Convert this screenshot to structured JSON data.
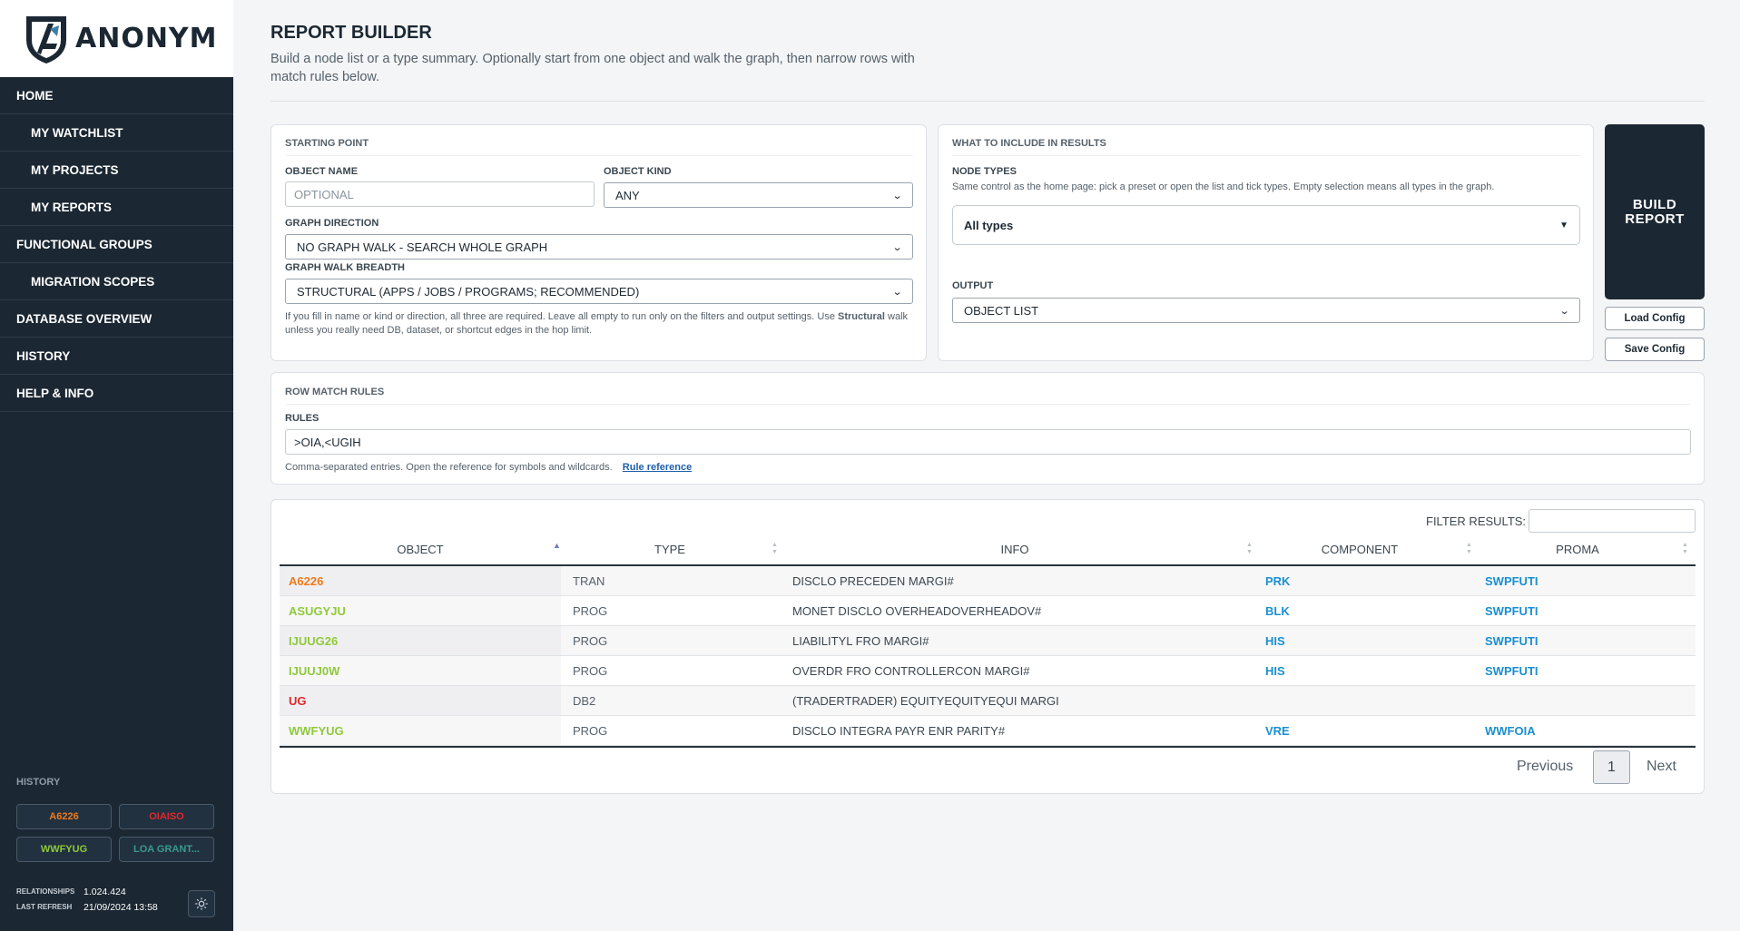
{
  "brand": {
    "name": "ANONYM"
  },
  "nav": [
    {
      "label": "HOME",
      "sub": false
    },
    {
      "label": "MY WATCHLIST",
      "sub": true
    },
    {
      "label": "MY PROJECTS",
      "sub": true
    },
    {
      "label": "MY REPORTS",
      "sub": true
    },
    {
      "label": "FUNCTIONAL GROUPS",
      "sub": false
    },
    {
      "label": "MIGRATION SCOPES",
      "sub": true
    },
    {
      "label": "DATABASE OVERVIEW",
      "sub": false
    },
    {
      "label": "HISTORY",
      "sub": false
    },
    {
      "label": "HELP & INFO",
      "sub": false
    }
  ],
  "history": {
    "title": "HISTORY",
    "chips": [
      {
        "label": "A6226",
        "color": "#f07a1a"
      },
      {
        "label": "OIAISO",
        "color": "#e0282c"
      },
      {
        "label": "WWFYUG",
        "color": "#8fc93a"
      },
      {
        "label": "LOA GRANT...",
        "color": "#3a9a8c"
      }
    ]
  },
  "stats": {
    "relationships_label": "RELATIONSHIPS",
    "relationships_value": "1.024.424",
    "refresh_label": "LAST REFRESH",
    "refresh_value": "21/09/2024 13:58"
  },
  "header": {
    "title": "REPORT BUILDER",
    "description": "Build a node list or a type summary. Optionally start from one object and walk the graph, then narrow rows with match rules below."
  },
  "starting_point": {
    "title": "STARTING POINT",
    "object_name_label": "OBJECT NAME",
    "object_name_placeholder": "OPTIONAL",
    "object_kind_label": "OBJECT KIND",
    "object_kind_value": "ANY",
    "graph_direction_label": "GRAPH DIRECTION",
    "graph_direction_value": "NO GRAPH WALK - SEARCH WHOLE GRAPH",
    "walk_breadth_label": "GRAPH WALK BREADTH",
    "walk_breadth_value": "STRUCTURAL (APPS / JOBS / PROGRAMS; RECOMMENDED)",
    "help_pre": "If you fill in name or kind or direction, all three are required. Leave all empty to run only on the filters and output settings. Use ",
    "help_bold": "Structural",
    "help_post": " walk unless you really need DB, dataset, or shortcut edges in the hop limit."
  },
  "include": {
    "title": "WHAT TO INCLUDE IN RESULTS",
    "node_types_label": "NODE TYPES",
    "node_types_help": "Same control as the home page: pick a preset or open the list and tick types. Empty selection means all types in the graph.",
    "node_types_value": "All types",
    "output_label": "OUTPUT",
    "output_value": "OBJECT LIST"
  },
  "actions": {
    "build_line1": "BUILD",
    "build_line2": "REPORT",
    "load": "Load Config",
    "save": "Save Config"
  },
  "rules": {
    "title": "ROW MATCH RULES",
    "label": "RULES",
    "value": ">OIA,<UGIH",
    "help": "Comma-separated entries. Open the reference for symbols and wildcards.",
    "link": "Rule reference"
  },
  "results": {
    "filter_label": "FILTER RESULTS:",
    "filter_value": "",
    "columns": [
      "OBJECT",
      "TYPE",
      "INFO",
      "COMPONENT",
      "PROMA"
    ],
    "rows": [
      {
        "object": "A6226",
        "object_color": "#f07a1a",
        "type": "TRAN",
        "info": "DISCLO PRECEDEN MARGI#",
        "component": "PRK",
        "proma": "SWPFUTI"
      },
      {
        "object": "ASUGYJU",
        "object_color": "#8fc93a",
        "type": "PROG",
        "info": "MONET DISCLO OVERHEADOVERHEADOV#",
        "component": "BLK",
        "proma": "SWPFUTI"
      },
      {
        "object": "IJUUG26",
        "object_color": "#8fc93a",
        "type": "PROG",
        "info": "LIABILITYL FRO MARGI#",
        "component": "HIS",
        "proma": "SWPFUTI"
      },
      {
        "object": "IJUUJ0W",
        "object_color": "#8fc93a",
        "type": "PROG",
        "info": "OVERDR FRO CONTROLLERCON MARGI#",
        "component": "HIS",
        "proma": "SWPFUTI"
      },
      {
        "object": "UG",
        "object_color": "#e0282c",
        "type": "DB2",
        "info": "(TRADERTRADER) EQUITYEQUITYEQUI MARGI",
        "component": "",
        "proma": ""
      },
      {
        "object": "WWFYUG",
        "object_color": "#8fc93a",
        "type": "PROG",
        "info": "DISCLO INTEGRA PAYR ENR PARITY#",
        "component": "VRE",
        "proma": "WWFOIA"
      }
    ],
    "link_color": "#1a8fd0",
    "pagination": {
      "previous": "Previous",
      "current": "1",
      "next": "Next"
    }
  }
}
